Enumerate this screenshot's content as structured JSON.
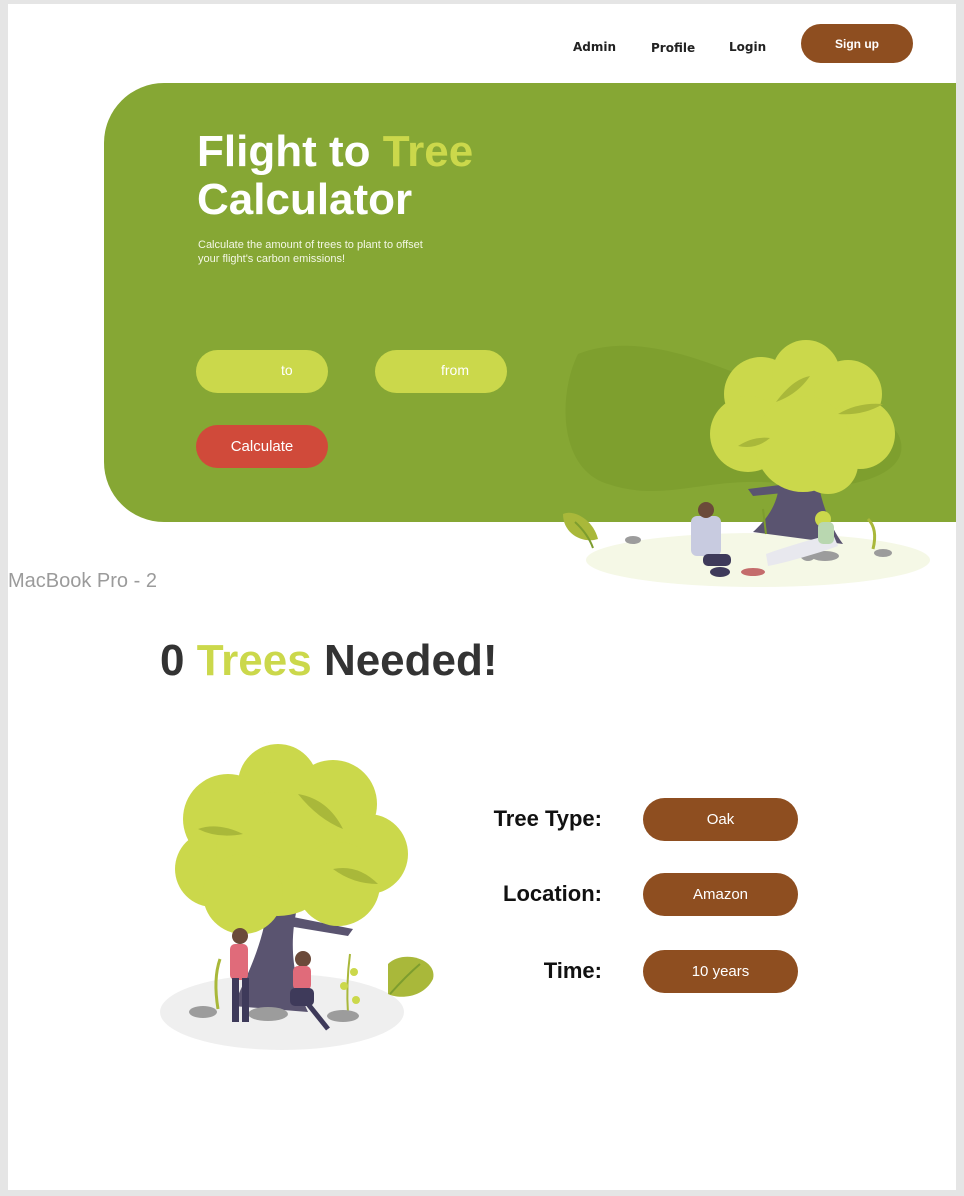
{
  "nav": {
    "admin": "Admin",
    "profile": "Profile",
    "login": "Login",
    "signup": "Sign up"
  },
  "hero": {
    "title_part1": "Flight to ",
    "title_accent": "Tree",
    "title_part2": "Calculator",
    "subtitle_line1": "Calculate the amount of trees to plant to offset",
    "subtitle_line2": "your flight's carbon emissions!",
    "to_placeholder": "to",
    "from_placeholder": "from",
    "calculate_label": "Calculate"
  },
  "frame_label": "MacBook Pro - 2",
  "result": {
    "count": "0",
    "accent": "Trees",
    "suffix": "Needed!"
  },
  "details": [
    {
      "label": "Tree Type:",
      "value": "Oak"
    },
    {
      "label": "Location:",
      "value": "Amazon"
    },
    {
      "label": "Time:",
      "value": "10 years"
    }
  ],
  "colors": {
    "hero_green": "#86a734",
    "accent_lime": "#cbd84b",
    "brown": "#8e4e20",
    "calculate_red": "#d04a3a"
  }
}
